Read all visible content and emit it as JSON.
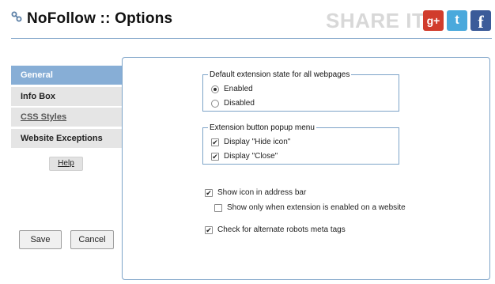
{
  "header": {
    "title": "NoFollow :: Options",
    "share_text": "SHARE IT",
    "social": [
      {
        "name": "google-plus",
        "glyph": "g+",
        "color": "#d13c2c"
      },
      {
        "name": "twitter",
        "glyph": "t",
        "color": "#4aa9dc"
      },
      {
        "name": "facebook",
        "glyph": "f",
        "color": "#3b5b99"
      }
    ]
  },
  "sidebar": {
    "items": [
      {
        "label": "General",
        "active": true
      },
      {
        "label": "Info Box",
        "active": false
      },
      {
        "label": "CSS Styles",
        "active": false
      },
      {
        "label": "Website Exceptions",
        "active": false
      }
    ],
    "help_label": "Help"
  },
  "actions": {
    "save_label": "Save",
    "cancel_label": "Cancel"
  },
  "general": {
    "default_state": {
      "legend": "Default extension state for all webpages",
      "options": [
        {
          "label": "Enabled",
          "selected": true
        },
        {
          "label": "Disabled",
          "selected": false
        }
      ]
    },
    "popup_menu": {
      "legend": "Extension button popup menu",
      "options": [
        {
          "label": "Display \"Hide icon\"",
          "checked": true
        },
        {
          "label": "Display \"Close\"",
          "checked": true
        }
      ]
    },
    "show_icon": {
      "label": "Show icon in address bar",
      "checked": true
    },
    "show_only_enabled": {
      "label": "Show only when extension is enabled on a website",
      "checked": false
    },
    "alt_robots": {
      "label": "Check for alternate robots meta tags",
      "checked": true
    }
  },
  "colors": {
    "accent": "#87aed6",
    "border": "#7da3c8",
    "nav_bg": "#e5e5e5"
  }
}
